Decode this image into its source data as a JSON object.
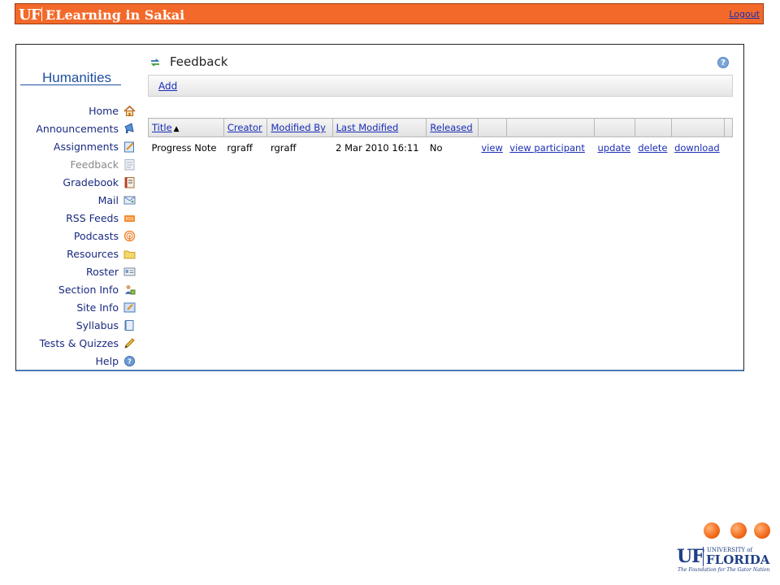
{
  "header": {
    "logo": "UF",
    "title": "ELearning in Sakai",
    "logout": "Logout"
  },
  "site": {
    "name": "Humanities"
  },
  "nav": [
    {
      "label": "Home",
      "icon": "home-icon",
      "active": false
    },
    {
      "label": "Announcements",
      "icon": "megaphone-icon",
      "active": false
    },
    {
      "label": "Assignments",
      "icon": "assignment-icon",
      "active": false
    },
    {
      "label": "Feedback",
      "icon": "feedback-icon",
      "active": true
    },
    {
      "label": "Gradebook",
      "icon": "gradebook-icon",
      "active": false
    },
    {
      "label": "Mail",
      "icon": "mail-icon",
      "active": false
    },
    {
      "label": "RSS Feeds",
      "icon": "rss-icon",
      "active": false
    },
    {
      "label": "Podcasts",
      "icon": "podcast-icon",
      "active": false
    },
    {
      "label": "Resources",
      "icon": "folder-icon",
      "active": false
    },
    {
      "label": "Roster",
      "icon": "roster-icon",
      "active": false
    },
    {
      "label": "Section Info",
      "icon": "section-icon",
      "active": false
    },
    {
      "label": "Site Info",
      "icon": "siteinfo-icon",
      "active": false
    },
    {
      "label": "Syllabus",
      "icon": "syllabus-icon",
      "active": false
    },
    {
      "label": "Tests & Quizzes",
      "icon": "pencil-icon",
      "active": false
    },
    {
      "label": "Help",
      "icon": "help-icon",
      "active": false
    }
  ],
  "tool": {
    "title": "Feedback",
    "add_label": "Add",
    "help_glyph": "?"
  },
  "table": {
    "columns": [
      "Title",
      "Creator",
      "Modified By",
      "Last Modified",
      "Released",
      "",
      "",
      "",
      "",
      "",
      ""
    ],
    "rows": [
      {
        "title": "Progress Note",
        "creator": "rgraff",
        "modified_by": "rgraff",
        "last_modified": "2 Mar 2010 16:11",
        "released": "No",
        "actions": [
          "view",
          "view participant",
          "update",
          "delete",
          "download"
        ]
      }
    ]
  },
  "footer_logo": {
    "uf": "UF",
    "university_of": "UNIVERSITY of",
    "florida": "FLORIDA",
    "tagline": "The Foundation for The Gator Nation"
  },
  "colors": {
    "banner": "#f3692a",
    "link": "#1a2eb5",
    "nav_text": "#1a2a80",
    "site_name": "#1f4fa0"
  }
}
